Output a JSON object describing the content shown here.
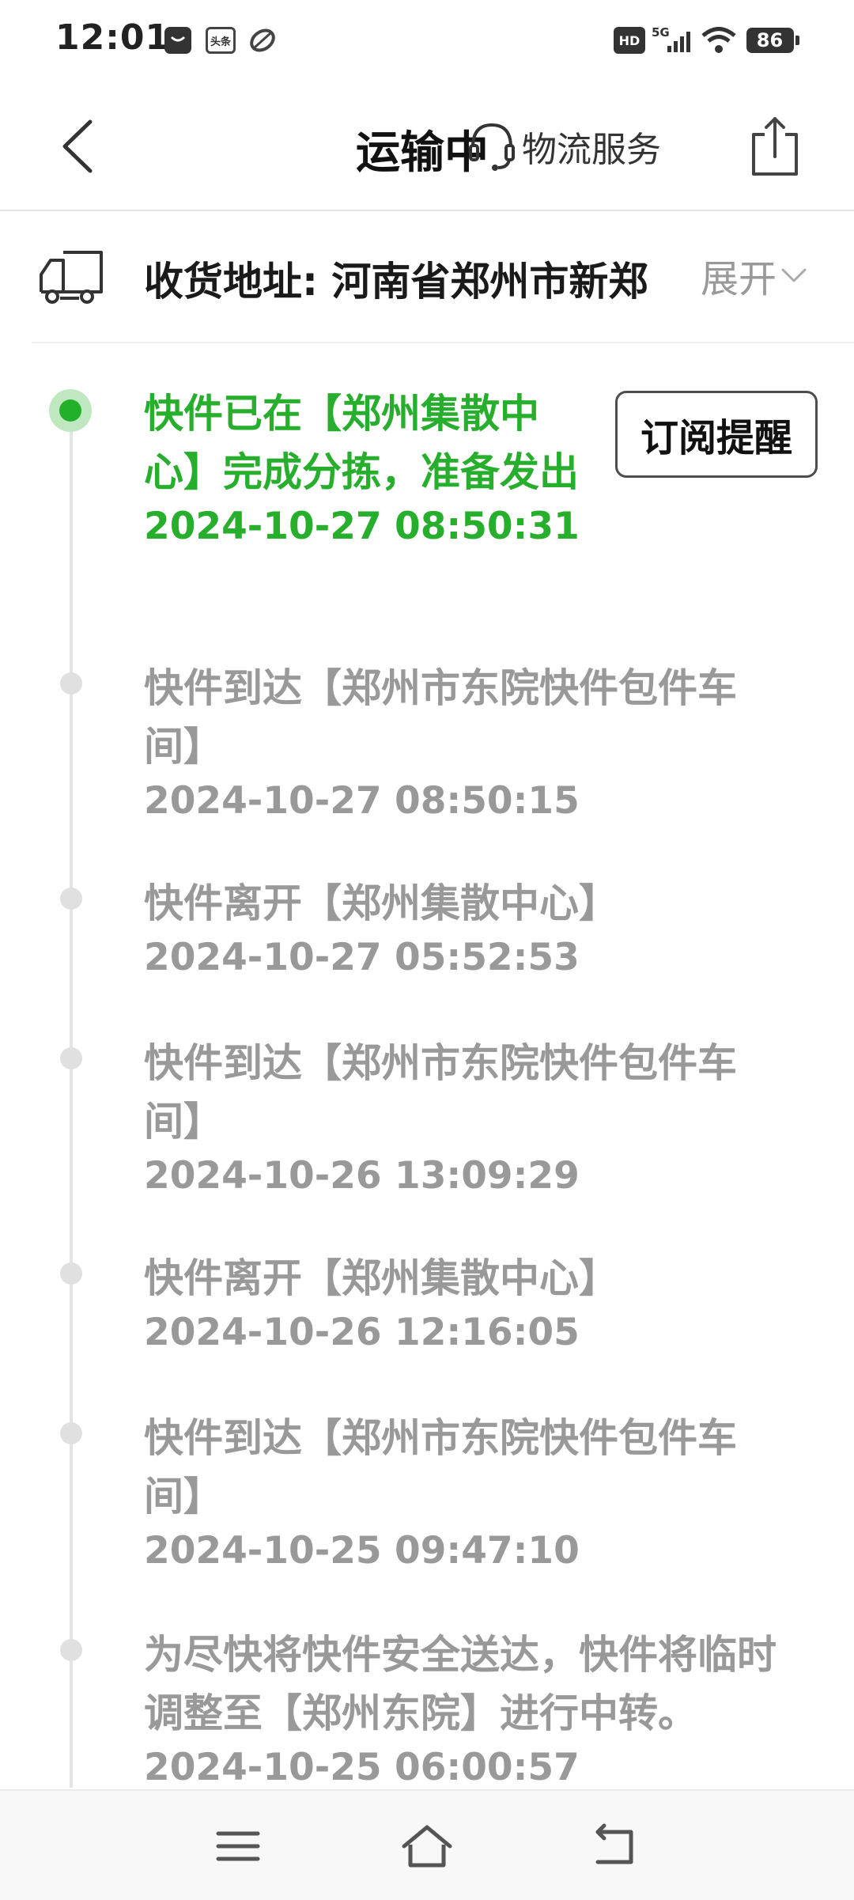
{
  "status_bar": {
    "time": "12:01",
    "toutiao_label": "头条",
    "hd_label": "HD",
    "network_label": "5G",
    "battery_level": "86",
    "icons": [
      "message-icon",
      "toutiao-app-icon",
      "leaf-app-icon",
      "hd-icon",
      "signal-icon",
      "wifi-icon",
      "battery-icon"
    ]
  },
  "header": {
    "title": "运输中",
    "service_label": "物流服务",
    "icons": [
      "back-icon",
      "headset-icon",
      "share-icon"
    ]
  },
  "address": {
    "text": "收货地址: 河南省郑州市新郑",
    "expand_label": "展开",
    "icons": [
      "truck-icon",
      "chevron-down-icon"
    ]
  },
  "subscribe_label": "订阅提醒",
  "colors": {
    "accent_green": "#26ae2c",
    "inactive_gray": "#999999"
  },
  "events": [
    {
      "desc": "快件已在【郑州集散中心】完成分拣，准备发出",
      "time": "2024-10-27 08:50:31"
    },
    {
      "desc": "快件到达【郑州市东院快件包件车间】",
      "time": "2024-10-27 08:50:15"
    },
    {
      "desc": "快件离开【郑州集散中心】",
      "time": "2024-10-27 05:52:53"
    },
    {
      "desc": "快件到达【郑州市东院快件包件车间】",
      "time": "2024-10-26 13:09:29"
    },
    {
      "desc": "快件离开【郑州集散中心】",
      "time": "2024-10-26 12:16:05"
    },
    {
      "desc": "快件到达【郑州市东院快件包件车间】",
      "time": "2024-10-25 09:47:10"
    },
    {
      "desc": "为尽快将快件安全送达，快件将临时调整至【郑州东院】进行中转。",
      "time": "2024-10-25 06:00:57"
    }
  ],
  "nav_icons": [
    "menu-icon",
    "home-icon",
    "back-nav-icon"
  ]
}
